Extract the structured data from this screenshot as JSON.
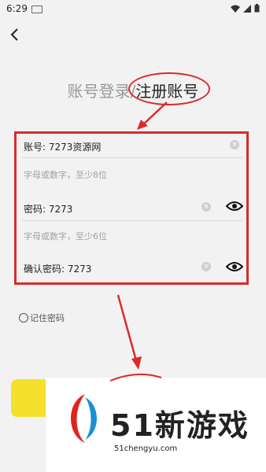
{
  "status_bar": {
    "time": "6:29"
  },
  "title": {
    "login": "账号登录",
    "separator": "/",
    "register": "注册账号"
  },
  "form": {
    "account_label": "账号: 7273资源网",
    "account_hint": "字母或数字，至少8位",
    "password_label": "密码: 7273",
    "password_hint": "字母或数字，至少6位",
    "confirm_label": "确认密码: 7273"
  },
  "remember": "记住密码",
  "watermark": {
    "text": "51新游戏",
    "url": "51chengyu.com"
  },
  "colors": {
    "annotation": "#d92b2b",
    "accent": "#f5e12b"
  },
  "icons": [
    "back-arrow-icon",
    "wifi-icon",
    "signal-icon",
    "battery-icon",
    "clear-icon",
    "eye-icon"
  ]
}
